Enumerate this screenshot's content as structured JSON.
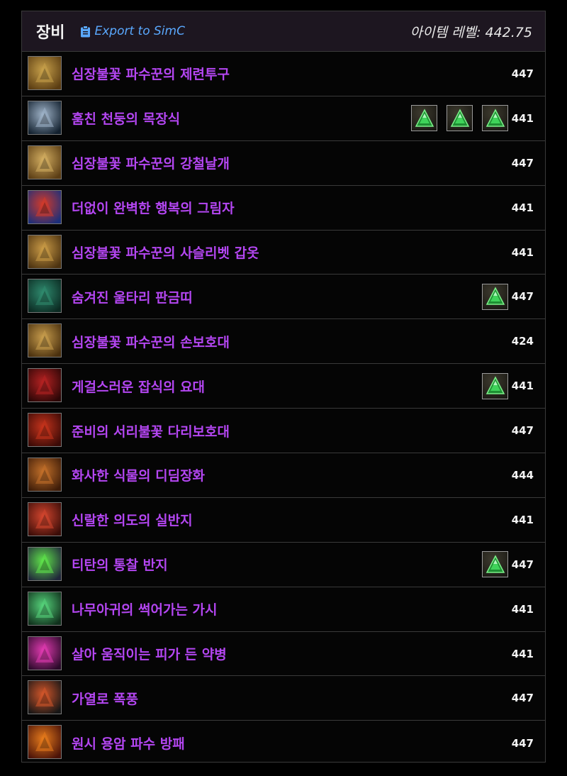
{
  "header": {
    "title": "장비",
    "export_label": "Export to SimC",
    "item_level_label": "아이템 레벨: 442.75"
  },
  "colors": {
    "item_name": "#b446f2",
    "export_link": "#5aa9ff",
    "gem": "#2fc24a"
  },
  "items": [
    {
      "name": "심장불꽃 파수꾼의 제련투구",
      "level": "447",
      "gems": 0,
      "icon": "gold-helm-icon",
      "c1": "#c7a04a",
      "c2": "#5a3c12"
    },
    {
      "name": "훔친 천둥의 목장식",
      "level": "441",
      "gems": 3,
      "icon": "storm-necklace-icon",
      "c1": "#9fb3c8",
      "c2": "#12202e"
    },
    {
      "name": "심장불꽃 파수꾼의 강철날개",
      "level": "447",
      "gems": 0,
      "icon": "gold-shoulders-icon",
      "c1": "#d2ad60",
      "c2": "#5b3d14"
    },
    {
      "name": "더없이 완벽한 행복의 그림자",
      "level": "441",
      "gems": 0,
      "icon": "red-cloak-icon",
      "c1": "#d23a2a",
      "c2": "#1c2f7a"
    },
    {
      "name": "심장불꽃 파수꾼의 사슬리벳 갑옷",
      "level": "441",
      "gems": 0,
      "icon": "gold-chest-icon",
      "c1": "#c99a46",
      "c2": "#4c3210"
    },
    {
      "name": "숨겨진 울타리 판금띠",
      "level": "447",
      "gems": 1,
      "icon": "green-bracer-icon",
      "c1": "#2f8a6e",
      "c2": "#0b2a22"
    },
    {
      "name": "심장불꽃 파수꾼의 손보호대",
      "level": "424",
      "gems": 0,
      "icon": "gold-gauntlets-icon",
      "c1": "#c79c4c",
      "c2": "#4a300e"
    },
    {
      "name": "게걸스러운 잡식의 요대",
      "level": "441",
      "gems": 1,
      "icon": "red-belt-icon",
      "c1": "#b52222",
      "c2": "#2b0606"
    },
    {
      "name": "준비의 서리불꽃 다리보호대",
      "level": "447",
      "gems": 0,
      "icon": "red-legs-icon",
      "c1": "#c4331c",
      "c2": "#3a0a06"
    },
    {
      "name": "화사한 식물의 디딤장화",
      "level": "444",
      "gems": 0,
      "icon": "leather-boots-icon",
      "c1": "#c2702a",
      "c2": "#3e1c08"
    },
    {
      "name": "신랄한 의도의 실반지",
      "level": "441",
      "gems": 0,
      "icon": "red-ring-icon",
      "c1": "#d2452e",
      "c2": "#3a0d08"
    },
    {
      "name": "티탄의 통찰 반지",
      "level": "447",
      "gems": 1,
      "icon": "green-ring-icon",
      "c1": "#5fe34a",
      "c2": "#20263a"
    },
    {
      "name": "나무아귀의 썩어가는 가시",
      "level": "441",
      "gems": 0,
      "icon": "green-thorn-icon",
      "c1": "#55d27a",
      "c2": "#10301c"
    },
    {
      "name": "살아 움직이는 피가 든 약병",
      "level": "441",
      "gems": 0,
      "icon": "pink-vial-icon",
      "c1": "#e03ab0",
      "c2": "#2b0a2a"
    },
    {
      "name": "가열로 폭풍",
      "level": "447",
      "gems": 0,
      "icon": "dark-axe-icon",
      "c1": "#d2562a",
      "c2": "#161616"
    },
    {
      "name": "원시 용암 파수 방패",
      "level": "447",
      "gems": 0,
      "icon": "lava-shield-icon",
      "c1": "#e57a1c",
      "c2": "#4a1208"
    }
  ]
}
